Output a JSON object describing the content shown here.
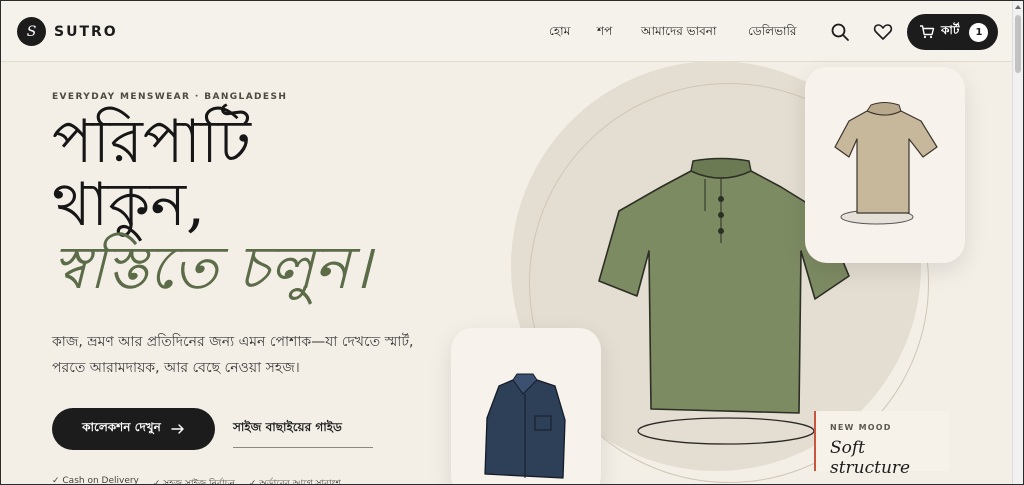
{
  "brand": {
    "mark": "S",
    "name": "SUTRO"
  },
  "nav": {
    "home": "হোম",
    "shop": "শপ",
    "idea": "আমাদের ভাবনা",
    "delivery": "ডেলিভারি"
  },
  "cart": {
    "label": "কার্ট",
    "count": "1"
  },
  "hero": {
    "eyebrow": "EVERYDAY MENSWEAR · BANGLADESH",
    "line1": "পরিপাটি",
    "line2": "থাকুন,",
    "line3": "স্বস্তিতে চলুন।",
    "lead": "কাজ, ভ্রমণ আর প্রতিদিনের জন্য এমন পোশাক—যা দেখতে স্মার্ট, পরতে আরামদায়ক, আর বেছে নেওয়া সহজ।",
    "primary_button": "কালেকশন দেখুন",
    "secondary_button": "সাইজ বাছাইয়ের গাইড"
  },
  "features": [
    "✓ Cash on Delivery",
    "✓ সহজ সাইজ নির্বাচন",
    "✓ অর্ডারের আগে সারাংশ"
  ],
  "mood": {
    "label": "NEW MOOD",
    "title": "Soft structure"
  },
  "icons": {
    "search": "search-icon",
    "wishlist": "heart-icon",
    "cart": "cart-icon",
    "arrow": "arrow-right-icon"
  },
  "colors": {
    "accent_green": "#5c6b48",
    "dark": "#1c1c1c",
    "background": "#f3efe7",
    "mood_border": "#c8553d"
  }
}
